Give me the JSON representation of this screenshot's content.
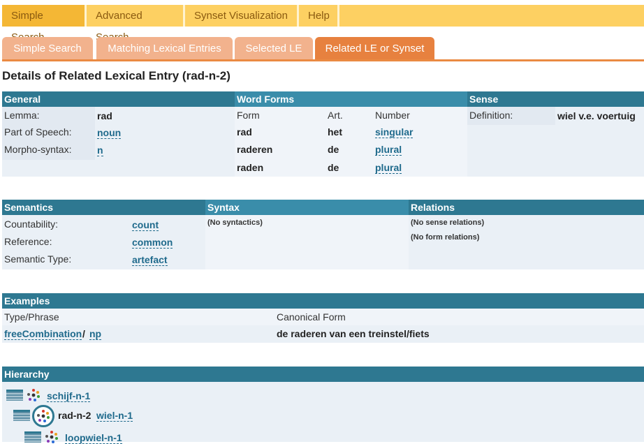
{
  "topnav": {
    "items": [
      {
        "label": "Simple Search"
      },
      {
        "label": "Advanced Search"
      },
      {
        "label": "Synset Visualization"
      },
      {
        "label": "Help"
      }
    ]
  },
  "tabs": [
    {
      "label": "Simple Search"
    },
    {
      "label": "Matching Lexical Entries"
    },
    {
      "label": "Selected LE"
    },
    {
      "label": "Related LE or Synset"
    }
  ],
  "title": "Details of Related Lexical Entry (rad-n-2)",
  "general": {
    "header": "General",
    "rows": [
      {
        "label": "Lemma:",
        "value": "rad"
      },
      {
        "label": "Part of Speech:",
        "value": "noun"
      },
      {
        "label": "Morpho-syntax:",
        "value": "n"
      }
    ]
  },
  "word_forms": {
    "header": "Word Forms",
    "columns": [
      "Form",
      "Art.",
      "Number"
    ],
    "rows": [
      {
        "form": "rad",
        "art": "het",
        "number": "singular"
      },
      {
        "form": "raderen",
        "art": "de",
        "number": "plural"
      },
      {
        "form": "raden",
        "art": "de",
        "number": "plural"
      }
    ]
  },
  "sense": {
    "header": "Sense",
    "label": "Definition:",
    "value": "wiel v.e. voertuig"
  },
  "semantics": {
    "header": "Semantics",
    "rows": [
      {
        "label": "Countability:",
        "value": "count"
      },
      {
        "label": "Reference:",
        "value": "common"
      },
      {
        "label": "Semantic Type:",
        "value": "artefact"
      }
    ]
  },
  "syntax": {
    "header": "Syntax",
    "note": "(No syntactics)"
  },
  "relations": {
    "header": "Relations",
    "notes": [
      "(No sense relations)",
      "(No form relations)"
    ]
  },
  "examples": {
    "header": "Examples",
    "columns": [
      "Type/Phrase",
      "Canonical Form"
    ],
    "row": {
      "type": "freeCombination",
      "sep": "/",
      "phrase": "np",
      "canonical": "de raderen van een treinstel/fiets"
    }
  },
  "hierarchy": {
    "header": "Hierarchy",
    "items": [
      {
        "link": "schijf-n-1"
      },
      {
        "current": "rad-n-2",
        "link": "wiel-n-1"
      },
      {
        "link": "loopwiel-n-1"
      }
    ]
  }
}
